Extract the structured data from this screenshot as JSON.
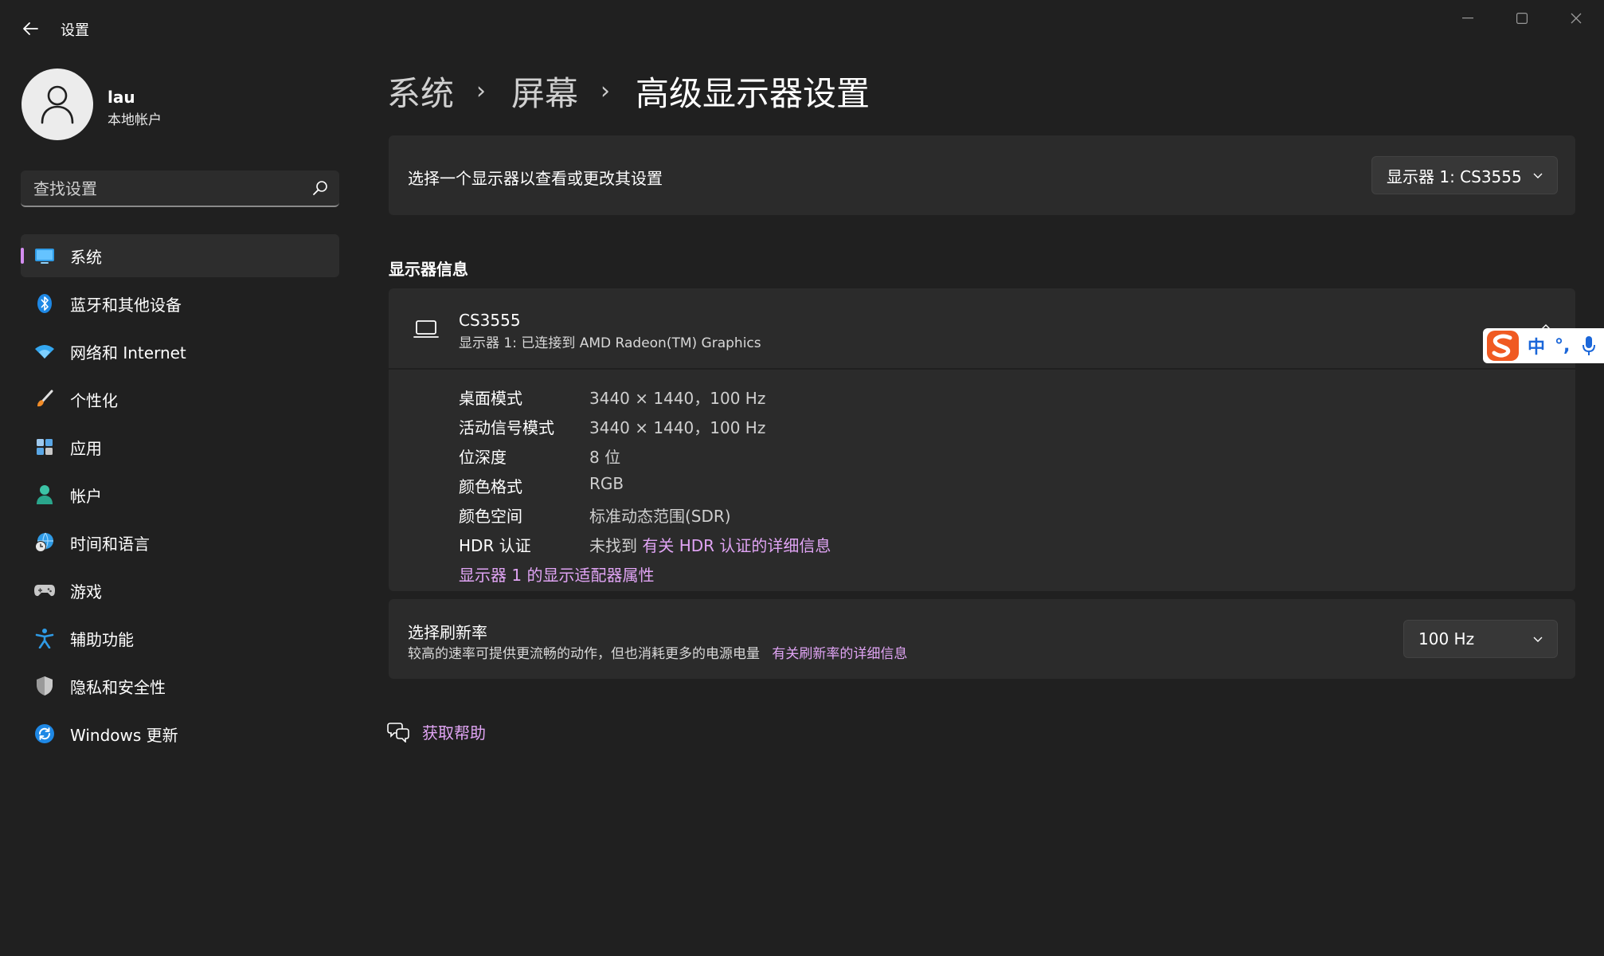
{
  "window": {
    "title": "设置",
    "controls": {
      "minimize": "minimize",
      "maximize": "maximize",
      "close": "close"
    }
  },
  "user": {
    "name": "lau",
    "account_type": "本地帐户"
  },
  "search": {
    "placeholder": "查找设置"
  },
  "sidebar": {
    "active_index": 0,
    "items": [
      {
        "label": "系统",
        "icon": "monitor-icon"
      },
      {
        "label": "蓝牙和其他设备",
        "icon": "bluetooth-icon"
      },
      {
        "label": "网络和 Internet",
        "icon": "wifi-icon"
      },
      {
        "label": "个性化",
        "icon": "brush-icon"
      },
      {
        "label": "应用",
        "icon": "apps-icon"
      },
      {
        "label": "帐户",
        "icon": "account-icon"
      },
      {
        "label": "时间和语言",
        "icon": "globe-clock-icon"
      },
      {
        "label": "游戏",
        "icon": "gamepad-icon"
      },
      {
        "label": "辅助功能",
        "icon": "accessibility-icon"
      },
      {
        "label": "隐私和安全性",
        "icon": "shield-icon"
      },
      {
        "label": "Windows 更新",
        "icon": "update-icon"
      }
    ]
  },
  "breadcrumb": {
    "items": [
      "系统",
      "屏幕",
      "高级显示器设置"
    ],
    "separator": "›"
  },
  "display_select": {
    "label": "选择一个显示器以查看或更改其设置",
    "selected": "显示器 1: CS3555"
  },
  "display_info": {
    "section_title": "显示器信息",
    "monitor_name": "CS3555",
    "monitor_subtitle": "显示器 1: 已连接到 AMD Radeon(TM) Graphics",
    "rows": [
      {
        "key": "桌面模式",
        "value": "3440 × 1440，100 Hz"
      },
      {
        "key": "活动信号模式",
        "value": "3440 × 1440，100 Hz"
      },
      {
        "key": "位深度",
        "value": "8 位"
      },
      {
        "key": "颜色格式",
        "value": "RGB"
      },
      {
        "key": "颜色空间",
        "value": "标准动态范围(SDR)"
      }
    ],
    "hdr": {
      "key": "HDR 认证",
      "value": "未找到",
      "link": "有关 HDR 认证的详细信息"
    },
    "adapter_link": "显示器 1 的显示适配器属性"
  },
  "refresh_rate": {
    "title": "选择刷新率",
    "description": "较高的速率可提供更流畅的动作，但也消耗更多的电源电量",
    "link": "有关刷新率的详细信息",
    "selected": "100 Hz"
  },
  "help": {
    "label": "获取帮助"
  },
  "ime_toolbar": {
    "mode": "中",
    "punctuation": "°,"
  },
  "colors": {
    "background": "#202020",
    "card": "#2b2b2b",
    "accent_link": "#e0a4f4",
    "nav_indicator": "#d48ef0"
  }
}
